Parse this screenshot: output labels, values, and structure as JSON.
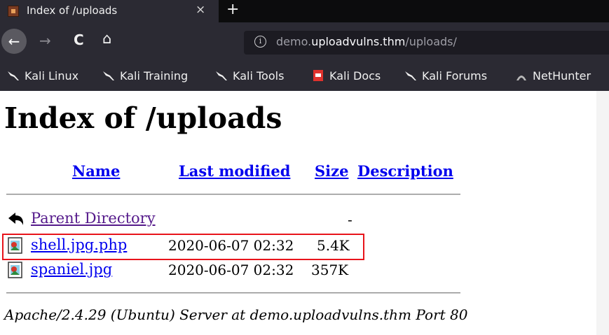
{
  "browser": {
    "tab": {
      "title": "Index of /uploads",
      "close": "×",
      "new_tab": "+"
    },
    "nav": {
      "back": "←",
      "forward": "→",
      "reload": "C",
      "home": "⌂"
    },
    "url": {
      "prefix": "demo.",
      "host": "uploadvulns.thm",
      "path": "/uploads/"
    },
    "bookmarks": [
      {
        "label": "Kali Linux",
        "icon": "kali-dragon-icon"
      },
      {
        "label": "Kali Training",
        "icon": "kali-dragon-icon"
      },
      {
        "label": "Kali Tools",
        "icon": "kali-dragon-icon"
      },
      {
        "label": "Kali Docs",
        "icon": "kali-docs-icon"
      },
      {
        "label": "Kali Forums",
        "icon": "kali-dragon-icon"
      },
      {
        "label": "NetHunter",
        "icon": "nethunter-icon"
      }
    ]
  },
  "page": {
    "title": "Index of /uploads",
    "columns": {
      "name": "Name",
      "modified": "Last modified",
      "size": "Size",
      "description": "Description"
    },
    "parent": {
      "name": "Parent Directory",
      "size": "-"
    },
    "files": [
      {
        "name": "shell.jpg.php",
        "modified": "2020-06-07 02:32",
        "size": "5.4K",
        "icon": "image-file-icon"
      },
      {
        "name": "spaniel.jpg",
        "modified": "2020-06-07 02:32",
        "size": "357K",
        "icon": "image-file-icon"
      }
    ],
    "footer": "Apache/2.4.29 (Ubuntu) Server at demo.uploadvulns.thm Port 80"
  },
  "colors": {
    "link": "#0000ee",
    "visited": "#551a8b",
    "highlight": "#e8141b"
  }
}
